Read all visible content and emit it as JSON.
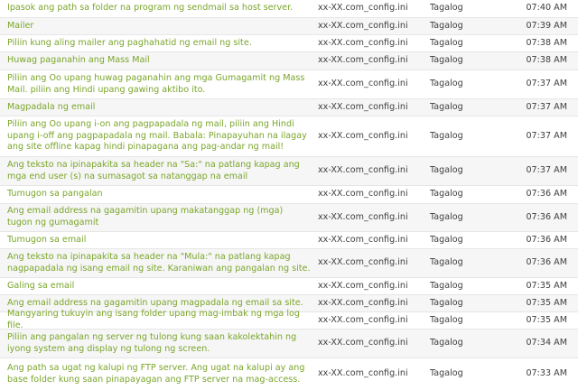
{
  "rows": [
    {
      "text": "Ipasok ang path sa folder na program ng sendmail sa host server.",
      "file": "xx-XX.com_config.ini",
      "language": "Tagalog",
      "time": "07:40 AM"
    },
    {
      "text": "Mailer",
      "file": "xx-XX.com_config.ini",
      "language": "Tagalog",
      "time": "07:39 AM"
    },
    {
      "text": "Piliin kung aling mailer ang paghahatid ng email ng site.",
      "file": "xx-XX.com_config.ini",
      "language": "Tagalog",
      "time": "07:38 AM"
    },
    {
      "text": "Huwag paganahin ang Mass Mail",
      "file": "xx-XX.com_config.ini",
      "language": "Tagalog",
      "time": "07:38 AM"
    },
    {
      "text": "Piliin ang Oo upang huwag paganahin ang mga Gumagamit ng Mass Mail. piliin ang Hindi upang gawing aktibo ito.",
      "file": "xx-XX.com_config.ini",
      "language": "Tagalog",
      "time": "07:37 AM"
    },
    {
      "text": "Magpadala ng email",
      "file": "xx-XX.com_config.ini",
      "language": "Tagalog",
      "time": "07:37 AM"
    },
    {
      "text": "Piliin ang Oo upang i-on ang pagpapadala ng mail, piliin ang Hindi upang i-off ang pagpapadala ng mail. Babala: Pinapayuhan na ilagay ang site offline kapag hindi pinapagana ang pag-andar ng mail!",
      "file": "xx-XX.com_config.ini",
      "language": "Tagalog",
      "time": "07:37 AM"
    },
    {
      "text": "Ang teksto na ipinapakita sa header na \"Sa:\" na patlang kapag ang mga end user (s) na sumasagot sa natanggap na email",
      "file": "xx-XX.com_config.ini",
      "language": "Tagalog",
      "time": "07:37 AM"
    },
    {
      "text": "Tumugon sa pangalan",
      "file": "xx-XX.com_config.ini",
      "language": "Tagalog",
      "time": "07:36 AM"
    },
    {
      "text": "Ang email address na gagamitin upang makatanggap ng (mga) tugon ng gumagamit",
      "file": "xx-XX.com_config.ini",
      "language": "Tagalog",
      "time": "07:36 AM"
    },
    {
      "text": "Tumugon sa email",
      "file": "xx-XX.com_config.ini",
      "language": "Tagalog",
      "time": "07:36 AM"
    },
    {
      "text": "Ang teksto na ipinapakita sa header na \"Mula:\" na patlang kapag nagpapadala ng isang email ng site. Karaniwan ang pangalan ng site.",
      "file": "xx-XX.com_config.ini",
      "language": "Tagalog",
      "time": "07:36 AM"
    },
    {
      "text": "Galing sa email",
      "file": "xx-XX.com_config.ini",
      "language": "Tagalog",
      "time": "07:35 AM"
    },
    {
      "text": "Ang email address na gagamitin upang magpadala ng email sa site.",
      "file": "xx-XX.com_config.ini",
      "language": "Tagalog",
      "time": "07:35 AM"
    },
    {
      "text": "Mangyaring tukuyin ang isang folder upang mag-imbak ng mga log file.",
      "file": "xx-XX.com_config.ini",
      "language": "Tagalog",
      "time": "07:35 AM"
    },
    {
      "text": "Piliin ang pangalan ng server ng tulong kung saan kakolektahin ng iyong system ang display ng tulong ng screen.",
      "file": "xx-XX.com_config.ini",
      "language": "Tagalog",
      "time": "07:34 AM"
    },
    {
      "text": "Ang path sa ugat ng kalupi ng FTP server. Ang ugat na kalupi ay ang base folder kung saan pinapayagan ang FTP server na mag-access.",
      "file": "xx-XX.com_config.ini",
      "language": "Tagalog",
      "time": "07:33 AM"
    }
  ]
}
